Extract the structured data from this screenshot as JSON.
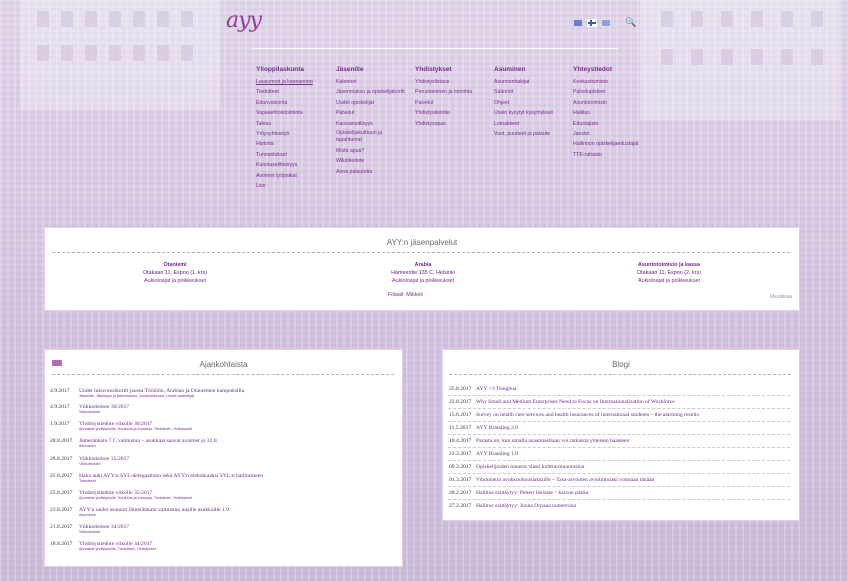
{
  "logo": "ayy",
  "nav": {
    "columns": [
      {
        "title": "Ylioppilaskunta",
        "items": [
          "Lausunnot ja kannanotot",
          "Tiedotteet",
          "Edunvalvonta",
          "Vapaaehtoistoiminta",
          "Talous",
          "Yritysyhteistyö",
          "Historia",
          "Tunnustukset",
          "Kunniaselitteisyys",
          "Avoimet työpaikat",
          "Live"
        ]
      },
      {
        "title": "Jäsenille",
        "items": [
          "Kalenteri",
          "Jäsenmaksu ja opiskelijakortti",
          "Uudet opiskelijat",
          "Palvelut",
          "Kansainvälisyys",
          "Opiskelijakulttuuri ja tapahtumat",
          "Mistä apua?",
          "Wikiotiedote",
          "Anna palautetta"
        ]
      },
      {
        "title": "Yhdistykset",
        "items": [
          "Yhdistyslistaus",
          "Perustaminen ja toiminta",
          "Palvelut",
          "Yhdistystietotie",
          "Yhdistysopas"
        ]
      },
      {
        "title": "Asuminen",
        "items": [
          "Asunnonhakijat",
          "Säännöt",
          "Ohjeet",
          "Usein kysytyt kysymykset",
          "Lomakkeet",
          "Vuot, puutteet ja palaute"
        ]
      },
      {
        "title": "Yhteystiedot",
        "items": [
          "Keskustoimisto",
          "Palvelupisteet",
          "Asuntotoimisto",
          "Hallitus",
          "Edustajisto",
          "Jaostot",
          "Hallinnon opiskelijaedustajat",
          "TTE-rahasto"
        ]
      }
    ]
  },
  "services": {
    "title": "AYY:n jäsenpalvelut",
    "offices": [
      {
        "name": "Otaniemi",
        "address": "Otakaari 11, Espoo (1. krs)",
        "link": "Aukioloajat ja poikkeukset"
      },
      {
        "name": "Arabia",
        "address": "Hämeentie 135 C, Helsinki",
        "link": "Aukioloajat ja poikkeukset"
      },
      {
        "name": "Asuntotoimisto ja kassa",
        "address": "Otakaari 11, Espoo (2. krs)",
        "link": "Aukioloajat ja poikkeukset"
      }
    ],
    "branch": "Filiaali: Mikkeli",
    "edit": "Muokkaa"
  },
  "news": {
    "title": "Ajankohtaista",
    "items": [
      {
        "date": "4.9.2017",
        "title": "Uudet lukuvuosikortit jaossa Töölöön, Arabian ja Otaniemen kampuksilla",
        "tags": "Jäsenille, Jäsenyys ja jäsenmaksu, Joukkoliikenne, Uudet opiskelijat"
      },
      {
        "date": "4.9.2017",
        "title": "Viikkotiedote 36/2017",
        "tags": "Viikkotiedote"
      },
      {
        "date": "1.9.2017",
        "title": "Yhdistystiedote viikolle 36/2017",
        "tags": "Apurahat yhdistyksille, Koulutus ja kursseja, Tiedotteet, Yhdistykset"
      },
      {
        "date": "28.8.2017",
        "title": "Jämeränkatu 7 C valmistuu – asukkaat saavat avaimet jo 31.8.",
        "tags": "Asuminen"
      },
      {
        "date": "28.8.2017",
        "title": "Viikkotiedote 35/2017",
        "tags": "Viikkotiedote"
      },
      {
        "date": "25.8.2017",
        "title": "Haku auki AYY:n SYL-delegaatioon sekä AYY:n ehdokkaaksi SYL:n hallitukseen",
        "tags": "Tiedotteet"
      },
      {
        "date": "25.8.2017",
        "title": "Yhdistystiedote viikolle 35/2017",
        "tags": "Apurahat yhdistyksille, Koulutus ja kursseja, Tiedotteet, Yhdistykset"
      },
      {
        "date": "23.8.2017",
        "title": "AYY:n uudet asunnot Jämeränkatu valmistuu uusille asukkaille 1.9.",
        "tags": "Asuminen"
      },
      {
        "date": "21.8.2017",
        "title": "Viikkotiedote 34/2017",
        "tags": "Viikkotiedote"
      },
      {
        "date": "18.8.2017",
        "title": "Yhdistystiedote viikolle 34/2017",
        "tags": "Apurahat yhdistyksille, Tiedotteet, Yhdistykset"
      }
    ]
  },
  "blog": {
    "title": "Blogi",
    "items": [
      {
        "date": "25.8.2017",
        "title": "AYY <3 Tsinghua"
      },
      {
        "date": "22.8.2017",
        "title": "Why Small and Medium Enterprises Need to Focus on Internationalization of Workforce"
      },
      {
        "date": "15.6.2017",
        "title": "Survey on health care services and health insurances of international students – the alarming results"
      },
      {
        "date": "11.5.2017",
        "title": "AYY Branding 2.0"
      },
      {
        "date": "18.4.2017",
        "title": "Parasta on, kun omalla osaamisellaan voi ratkaista yhteisen haasteen"
      },
      {
        "date": "23.3.2017",
        "title": "AYY Branding 1.0"
      },
      {
        "date": "09.3.2017",
        "title": "Opiskelijoiden muutos viasti kulttuurimuutostoa"
      },
      {
        "date": "01.3.2017",
        "title": "Vihdoinkin avokkoohouslakkiille – Tasa-arvoinen avioliittolaki voimaan tänään"
      },
      {
        "date": "28.2.2017",
        "title": "Hallitus esittäytyy: Petteri Heloste – kaivon pakka"
      },
      {
        "date": "27.2.2017",
        "title": "Hallitus esittäytyy: Joona Orpana numeroina"
      }
    ]
  }
}
